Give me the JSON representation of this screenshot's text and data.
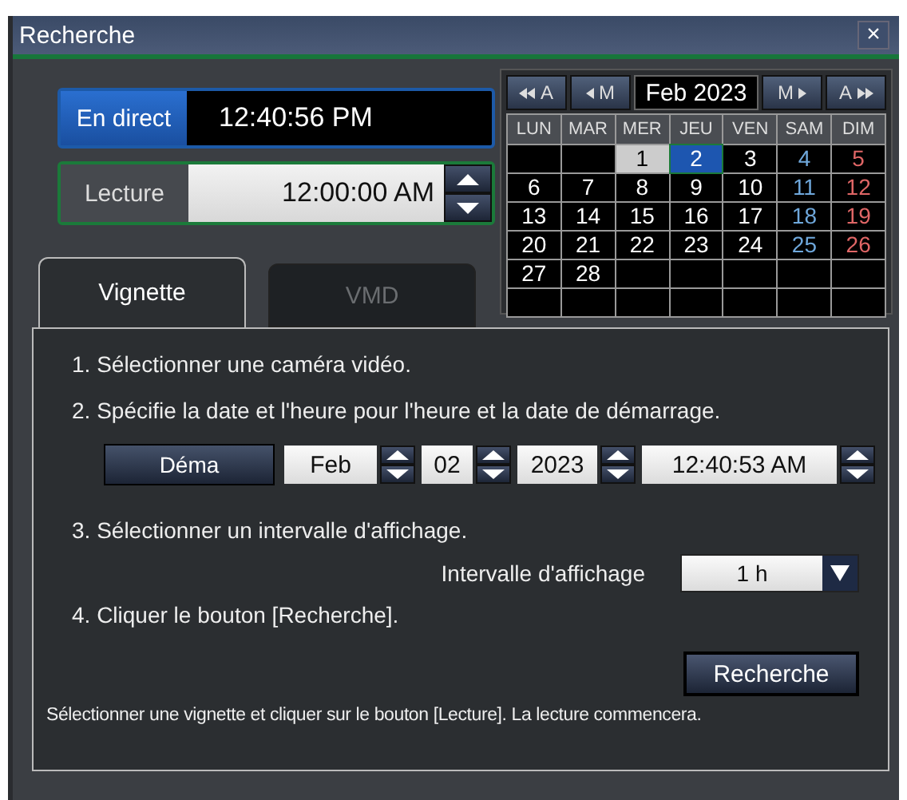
{
  "window": {
    "title": "Recherche",
    "close": "×"
  },
  "live": {
    "label": "En direct",
    "time": "12:40:56 PM"
  },
  "playback": {
    "label": "Lecture",
    "time": "12:00:00 AM"
  },
  "calendar": {
    "month": "Feb 2023",
    "nav": [
      {
        "label": "A",
        "kind": "prev-year"
      },
      {
        "label": "M",
        "kind": "prev-month"
      },
      {
        "label": "M",
        "kind": "next-month"
      },
      {
        "label": "A",
        "kind": "next-year"
      }
    ],
    "weekdays": [
      "LUN",
      "MAR",
      "MER",
      "JEU",
      "VEN",
      "SAM",
      "DIM"
    ],
    "weeks": [
      [
        {
          "kind": "empty"
        },
        {
          "kind": "empty"
        },
        {
          "kind": "weekday",
          "label": "1",
          "selected": false,
          "highlighted": true
        },
        {
          "kind": "weekday",
          "label": "2",
          "selected": true,
          "highlighted": false
        },
        {
          "kind": "weekday",
          "label": "3",
          "selected": false,
          "highlighted": false
        },
        {
          "kind": "saturday",
          "label": "4",
          "selected": false,
          "highlighted": false
        },
        {
          "kind": "sunday",
          "label": "5",
          "selected": false,
          "highlighted": false
        }
      ],
      [
        {
          "kind": "weekday",
          "label": "6",
          "selected": false,
          "highlighted": false
        },
        {
          "kind": "weekday",
          "label": "7",
          "selected": false,
          "highlighted": false
        },
        {
          "kind": "weekday",
          "label": "8",
          "selected": false,
          "highlighted": false
        },
        {
          "kind": "weekday",
          "label": "9",
          "selected": false,
          "highlighted": false
        },
        {
          "kind": "weekday",
          "label": "10",
          "selected": false,
          "highlighted": false
        },
        {
          "kind": "saturday",
          "label": "11",
          "selected": false,
          "highlighted": false
        },
        {
          "kind": "sunday",
          "label": "12",
          "selected": false,
          "highlighted": false
        }
      ],
      [
        {
          "kind": "weekday",
          "label": "13",
          "selected": false,
          "highlighted": false
        },
        {
          "kind": "weekday",
          "label": "14",
          "selected": false,
          "highlighted": false
        },
        {
          "kind": "weekday",
          "label": "15",
          "selected": false,
          "highlighted": false
        },
        {
          "kind": "weekday",
          "label": "16",
          "selected": false,
          "highlighted": false
        },
        {
          "kind": "weekday",
          "label": "17",
          "selected": false,
          "highlighted": false
        },
        {
          "kind": "saturday",
          "label": "18",
          "selected": false,
          "highlighted": false
        },
        {
          "kind": "sunday",
          "label": "19",
          "selected": false,
          "highlighted": false
        }
      ],
      [
        {
          "kind": "weekday",
          "label": "20",
          "selected": false,
          "highlighted": false
        },
        {
          "kind": "weekday",
          "label": "21",
          "selected": false,
          "highlighted": false
        },
        {
          "kind": "weekday",
          "label": "22",
          "selected": false,
          "highlighted": false
        },
        {
          "kind": "weekday",
          "label": "23",
          "selected": false,
          "highlighted": false
        },
        {
          "kind": "weekday",
          "label": "24",
          "selected": false,
          "highlighted": false
        },
        {
          "kind": "saturday",
          "label": "25",
          "selected": false,
          "highlighted": false
        },
        {
          "kind": "sunday",
          "label": "26",
          "selected": false,
          "highlighted": false
        }
      ],
      [
        {
          "kind": "weekday",
          "label": "27",
          "selected": false,
          "highlighted": false
        },
        {
          "kind": "weekday",
          "label": "28",
          "selected": false,
          "highlighted": false
        },
        {
          "kind": "empty"
        },
        {
          "kind": "empty"
        },
        {
          "kind": "empty"
        },
        {
          "kind": "empty"
        },
        {
          "kind": "empty"
        }
      ],
      [
        {
          "kind": "empty"
        },
        {
          "kind": "empty"
        },
        {
          "kind": "empty"
        },
        {
          "kind": "empty"
        },
        {
          "kind": "empty"
        },
        {
          "kind": "empty"
        },
        {
          "kind": "empty"
        }
      ]
    ]
  },
  "tabs": [
    {
      "label": "Vignette",
      "selected": true
    },
    {
      "label": "VMD",
      "selected": false
    }
  ],
  "steps": [
    "1. Sélectionner une caméra vidéo.",
    "2. Spécifie la date et l'heure pour l'heure et la date de démarrage."
  ],
  "start": {
    "button": "Déma",
    "month": "Feb",
    "day": "02",
    "year": "2023",
    "time": "12:40:53 AM"
  },
  "step3": "3. Sélectionner un intervalle d'affichage.",
  "interval": {
    "label": "Intervalle d'affichage",
    "value": "1 h"
  },
  "step4": "4. Cliquer le bouton [Recherche].",
  "search_button": "Recherche",
  "note": "Sélectionner une vignette et cliquer sur le bouton [Lecture]. La lecture commencera."
}
